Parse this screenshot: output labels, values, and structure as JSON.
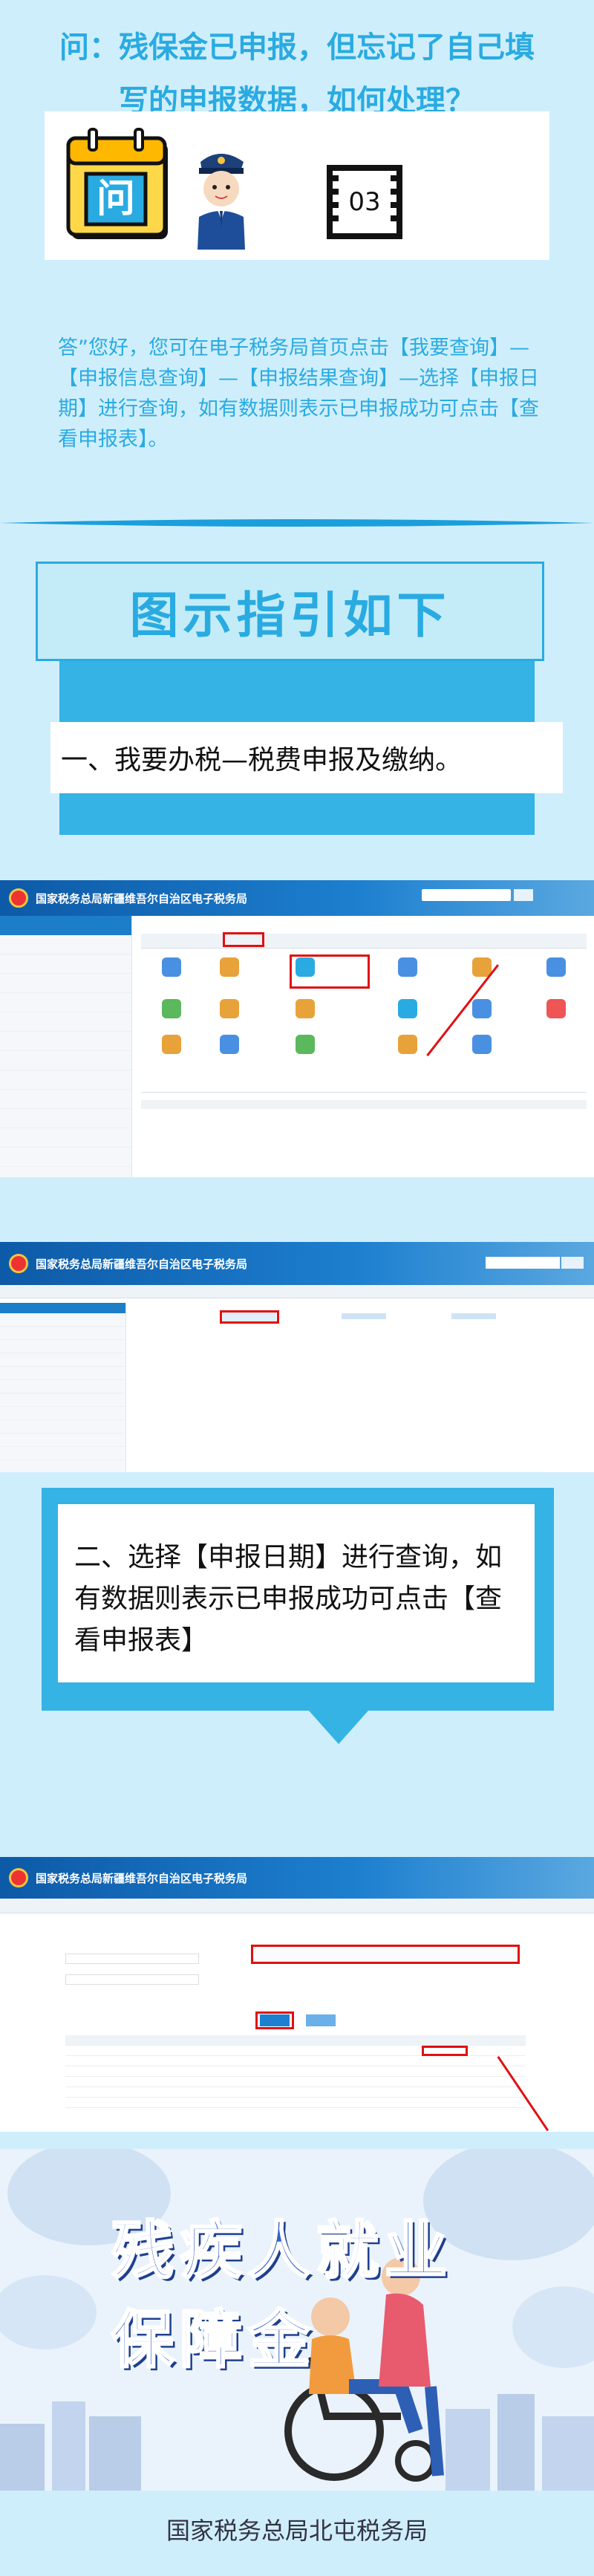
{
  "question": {
    "line1": "问：残保金已申报，但忘记了自己填",
    "line2": "写的申报数据，如何处理？"
  },
  "calendar_label": "问",
  "film_number": "03",
  "answer": "答”您好，您可在电子税务局首页点击【我要查询】—【申报信息查询】—【申报结果查询】—选择【申报日期】进行查询，如有数据则表示已申报成功可点击【查看申报表】。",
  "guide_title": "图示指引如下",
  "step1": "一、我要办税—税费申报及缴纳。",
  "step2": "二、选择【申报日期】进行查询，如有数据则表示已申报成功可点击【查看申报表】",
  "screenshot": {
    "site_title": "国家税务总局新疆维吾尔自治区电子税务局"
  },
  "banner": {
    "title_line1": "残疾人就业",
    "title_line2": "保障金"
  },
  "footer": "国家税务总局北屯税务局",
  "colors": {
    "accent": "#29abe2",
    "background": "#cfeefb",
    "highlight": "#e01010"
  }
}
